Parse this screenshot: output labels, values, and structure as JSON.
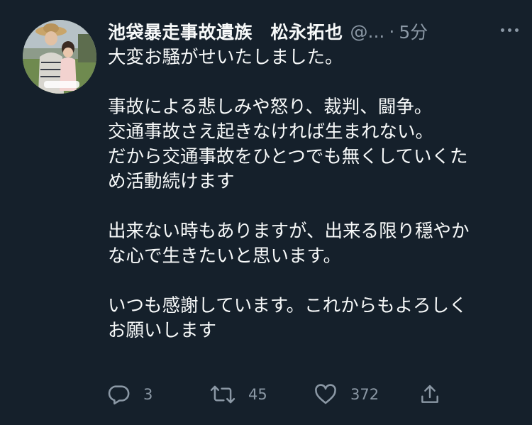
{
  "tweet": {
    "author_name": "池袋暴走事故遺族　松永拓也",
    "handle": "@...",
    "separator": "·",
    "time": "5分",
    "paragraphs": [
      [
        "大変お騒がせいたしました。"
      ],
      [
        "事故による悲しみや怒り、裁判、闘争。",
        "交通事故さえ起きなければ生まれない。",
        "だから交通事故をひとつでも無くしていくた",
        "め活動続けます"
      ],
      [
        "出来ない時もありますが、出来る限り穏やか",
        "な心で生きたいと思います。"
      ],
      [
        "いつも感謝しています。これからもよろしく",
        "お願いします"
      ]
    ],
    "actions": {
      "reply_count": "3",
      "retweet_count": "45",
      "like_count": "372"
    }
  },
  "icons": {
    "more": "more-icon",
    "reply": "reply-icon",
    "retweet": "retweet-icon",
    "like": "heart-icon",
    "share": "share-icon"
  },
  "colors": {
    "background": "#15202b",
    "text": "#f7f9f9",
    "secondary_text": "#8b98a5"
  }
}
